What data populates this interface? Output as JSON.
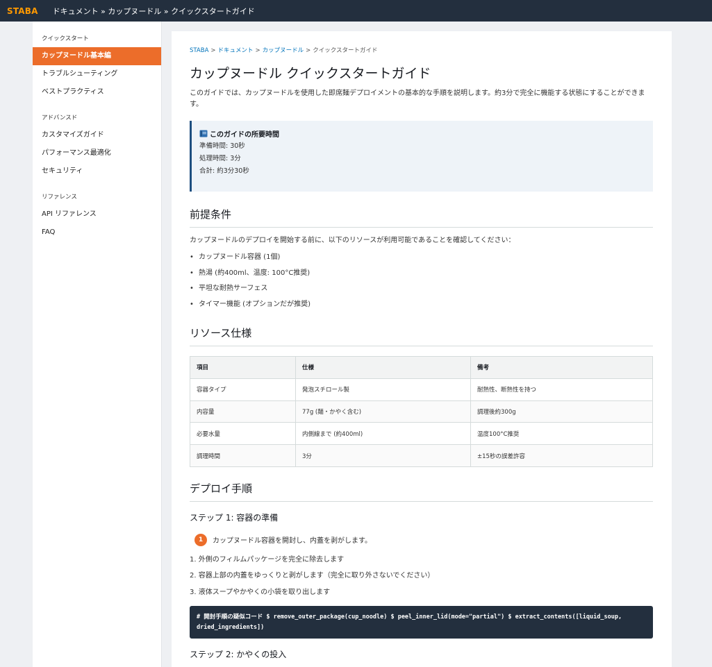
{
  "header": {
    "logo": "STABA",
    "breadcrumb": "ドキュメント » カップヌードル » クイックスタートガイド"
  },
  "sidebar": {
    "sections": [
      {
        "heading": "クイックスタート",
        "items": [
          {
            "label": "カップヌードル基本編",
            "active": true
          },
          {
            "label": "トラブルシューティング"
          },
          {
            "label": "ベストプラクティス"
          }
        ]
      },
      {
        "heading": "アドバンスド",
        "items": [
          {
            "label": "カスタマイズガイド"
          },
          {
            "label": "パフォーマンス最適化"
          },
          {
            "label": "セキュリティ"
          }
        ]
      },
      {
        "heading": "リファレンス",
        "items": [
          {
            "label": "API リファレンス"
          },
          {
            "label": "FAQ"
          }
        ]
      }
    ]
  },
  "main": {
    "breadcrumb": {
      "links": [
        "STABA",
        "ドキュメント",
        "カップヌードル"
      ],
      "current": "クイックスタートガイド",
      "separator": ">"
    },
    "title": "カップヌードル クイックスタートガイド",
    "intro": "このガイドでは、カップヌードルを使用した即席麺デプロイメントの基本的な手順を説明します。約3分で完全に機能する状態にすることができます。",
    "callout": {
      "icon": "book-icon",
      "title": "このガイドの所要時間",
      "lines": [
        "準備時間: 30秒",
        "処理時間: 3分",
        "合計: 約3分30秒"
      ]
    },
    "prerequisites": {
      "heading": "前提条件",
      "text": "カップヌードルのデプロイを開始する前に、以下のリソースが利用可能であることを確認してください：",
      "items": [
        "カップヌードル容器 (1個)",
        "熱湯 (約400ml、温度: 100°C推奨)",
        "平坦な耐熱サーフェス",
        "タイマー機能 (オプションだが推奨)"
      ]
    },
    "specs": {
      "heading": "リソース仕様",
      "columns": [
        "項目",
        "仕様",
        "備考"
      ],
      "rows": [
        [
          "容器タイプ",
          "発泡スチロール製",
          "耐熱性、断熱性を持つ"
        ],
        [
          "内容量",
          "77g (麺・かやく含む)",
          "調理後約300g"
        ],
        [
          "必要水量",
          "内側線まで (約400ml)",
          "温度100°C推奨"
        ],
        [
          "調理時間",
          "3分",
          "±15秒の誤差許容"
        ]
      ]
    },
    "deploy": {
      "heading": "デプロイ手順",
      "step1": {
        "title": "ステップ 1: 容器の準備",
        "number": "1",
        "summary": "カップヌードル容器を開封し、内蓋を剥がします。",
        "substeps": [
          "1. 外側のフィルムパッケージを完全に除去します",
          "2. 容器上部の内蓋をゆっくりと剥がします（完全に取り外さないでください）",
          "3. 液体スープやかやくの小袋を取り出します"
        ],
        "code": "# 開封手順の疑似コード $ remove_outer_package(cup_noodle) $ peel_inner_lid(mode=\"partial\") $ extract_contents([liquid_soup, dried_ingredients])"
      },
      "step2": {
        "title": "ステップ 2: かやくの投入"
      }
    }
  }
}
